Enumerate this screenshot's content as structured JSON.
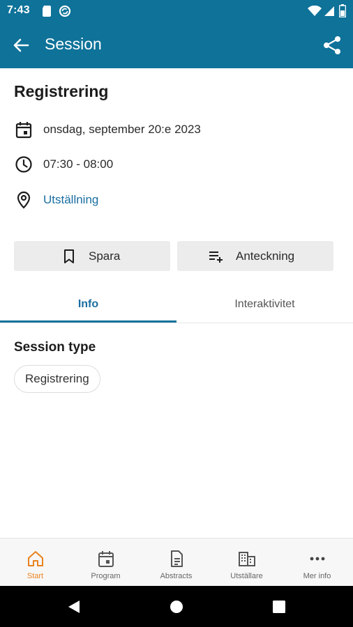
{
  "status_bar": {
    "time": "7:43",
    "icons": [
      "sd-card-icon",
      "sync-icon",
      "wifi-icon",
      "signal-icon",
      "battery-icon"
    ]
  },
  "app_bar": {
    "title": "Session",
    "back_icon": "arrow-back-icon",
    "share_icon": "share-icon"
  },
  "session": {
    "title": "Registrering",
    "date": "onsdag, september 20:e 2023",
    "time": "07:30 - 08:00",
    "location": "Utställning"
  },
  "actions": {
    "save_label": "Spara",
    "note_label": "Anteckning"
  },
  "tabs": [
    {
      "label": "Info",
      "active": true
    },
    {
      "label": "Interaktivitet",
      "active": false
    }
  ],
  "info": {
    "section_heading": "Session type",
    "chip": "Registrering"
  },
  "bottom_nav": [
    {
      "label": "Start",
      "icon": "home-icon",
      "active": true
    },
    {
      "label": "Program",
      "icon": "calendar-icon",
      "active": false
    },
    {
      "label": "Abstracts",
      "icon": "document-icon",
      "active": false
    },
    {
      "label": "Utställare",
      "icon": "building-icon",
      "active": false
    },
    {
      "label": "Mer info",
      "icon": "more-icon",
      "active": false
    }
  ],
  "colors": {
    "primary": "#0e7299",
    "link": "#1a6ea0",
    "active_nav": "#e9821e",
    "button_bg": "#ececec"
  }
}
